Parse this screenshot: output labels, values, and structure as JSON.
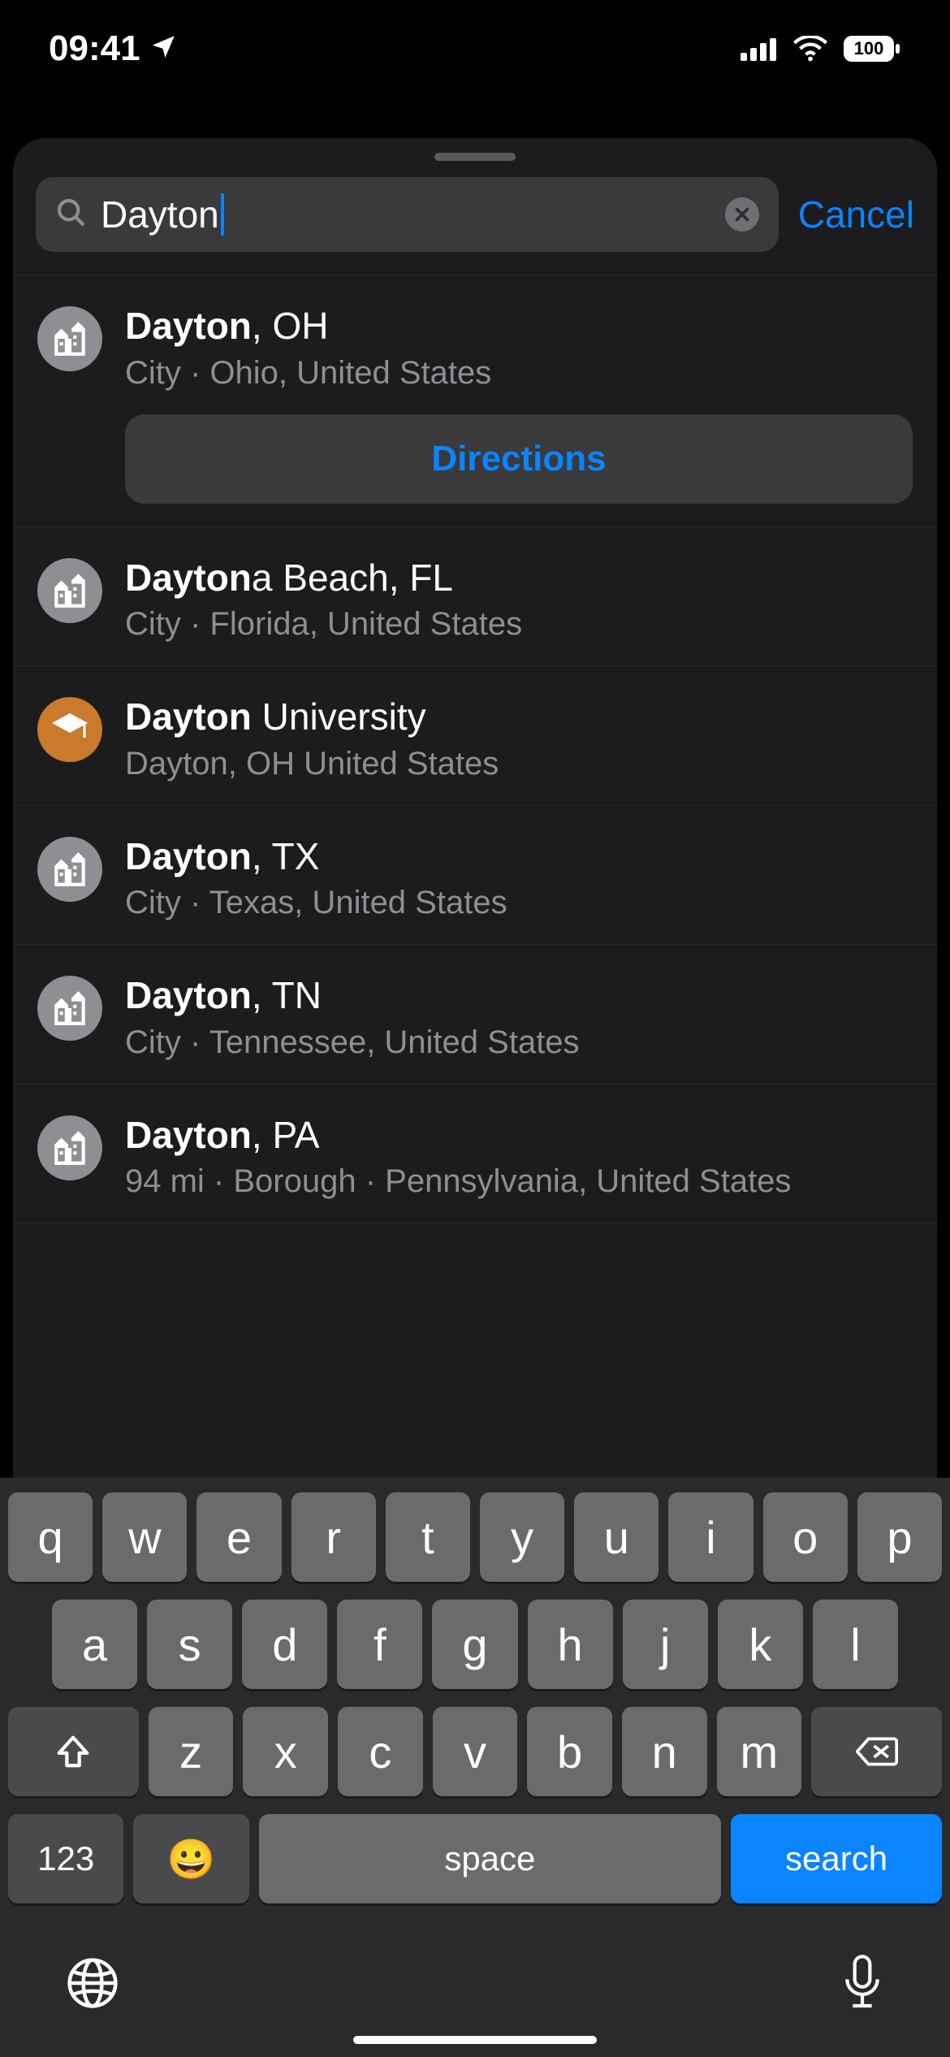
{
  "status": {
    "time": "09:41",
    "battery": "100"
  },
  "search": {
    "query": "Dayton",
    "cancel_label": "Cancel"
  },
  "results": [
    {
      "icon": "city",
      "title_bold": "Dayton",
      "title_rest": ", OH",
      "subtitle": "City · Ohio, United States",
      "directions_label": "Directions",
      "show_directions": true
    },
    {
      "icon": "city",
      "title_bold": "Dayton",
      "title_rest": "a Beach, FL",
      "subtitle": "City · Florida, United States"
    },
    {
      "icon": "edu",
      "title_bold": "Dayton",
      "title_rest": " University",
      "subtitle": "Dayton, OH  United States"
    },
    {
      "icon": "city",
      "title_bold": "Dayton",
      "title_rest": ", TX",
      "subtitle": "City · Texas, United States"
    },
    {
      "icon": "city",
      "title_bold": "Dayton",
      "title_rest": ", TN",
      "subtitle": "City · Tennessee, United States"
    },
    {
      "icon": "city",
      "title_bold": "Dayton",
      "title_rest": ", PA",
      "subtitle": "94 mi · Borough · Pennsylvania, United States"
    }
  ],
  "keyboard": {
    "row1": [
      "q",
      "w",
      "e",
      "r",
      "t",
      "y",
      "u",
      "i",
      "o",
      "p"
    ],
    "row2": [
      "a",
      "s",
      "d",
      "f",
      "g",
      "h",
      "j",
      "k",
      "l"
    ],
    "row3": [
      "z",
      "x",
      "c",
      "v",
      "b",
      "n",
      "m"
    ],
    "num_label": "123",
    "space_label": "space",
    "search_label": "search"
  }
}
